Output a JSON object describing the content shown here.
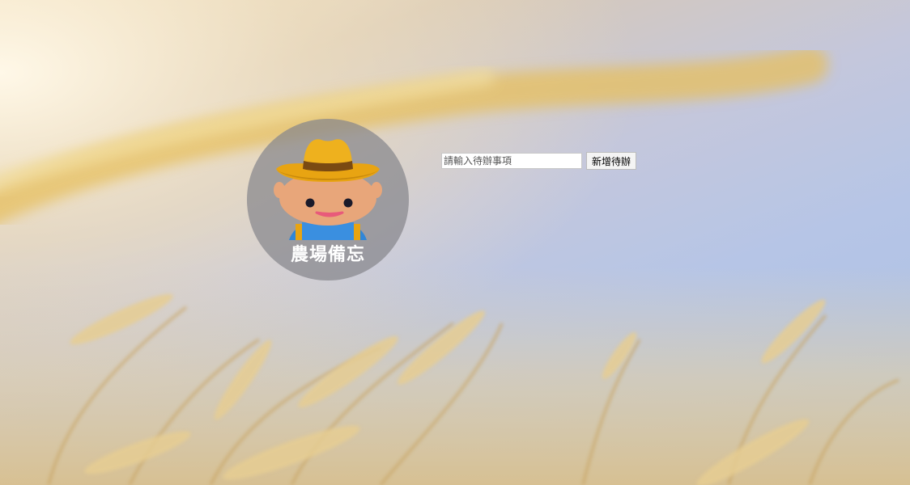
{
  "logo": {
    "icon": "farmer-icon",
    "title": "農場備忘"
  },
  "todo_form": {
    "input_value": "",
    "input_placeholder": "請輸入待辦事項",
    "add_button_label": "新增待辦"
  },
  "colors": {
    "hat": "#e8a412",
    "hat_band": "#7a4a12",
    "face": "#e8a67a",
    "overalls": "#2f86d8",
    "logo_title": "#ffffff"
  }
}
